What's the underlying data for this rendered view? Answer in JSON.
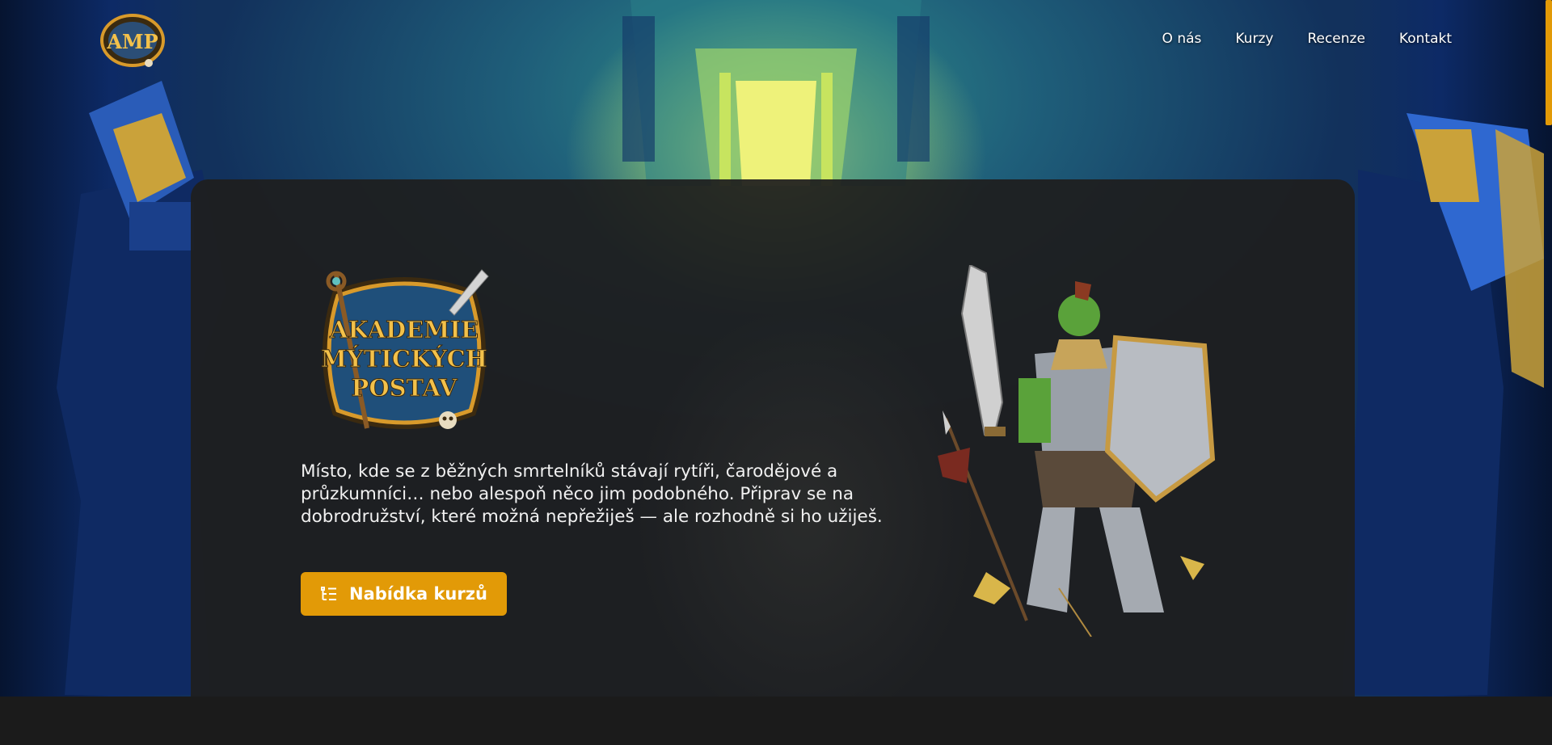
{
  "header": {
    "logo_text": "AMP",
    "nav": [
      {
        "label": "O nás"
      },
      {
        "label": "Kurzy"
      },
      {
        "label": "Recenze"
      },
      {
        "label": "Kontakt"
      }
    ]
  },
  "hero": {
    "emblem_text": [
      "AKADEMIE",
      "MÝTICKÝCH",
      "POSTAV"
    ],
    "tagline": "Místo, kde se z běžných smrtelníků stávají rytíři, čarodějové a průzkumníci… nebo alespoň něco jim podobného. Připrav se na dobrodružství, které možná nepřežiješ — ale rozhodně si ho užiješ.",
    "cta_label": "Nabídka kurzů",
    "cta_icon": "list-icon",
    "character_image": "orc-warrior-illustration"
  },
  "colors": {
    "accent": "#e29a07",
    "panel": "#1e1e1e",
    "emblem_fill": "#1f4f7a",
    "emblem_border": "#d89a2b"
  }
}
